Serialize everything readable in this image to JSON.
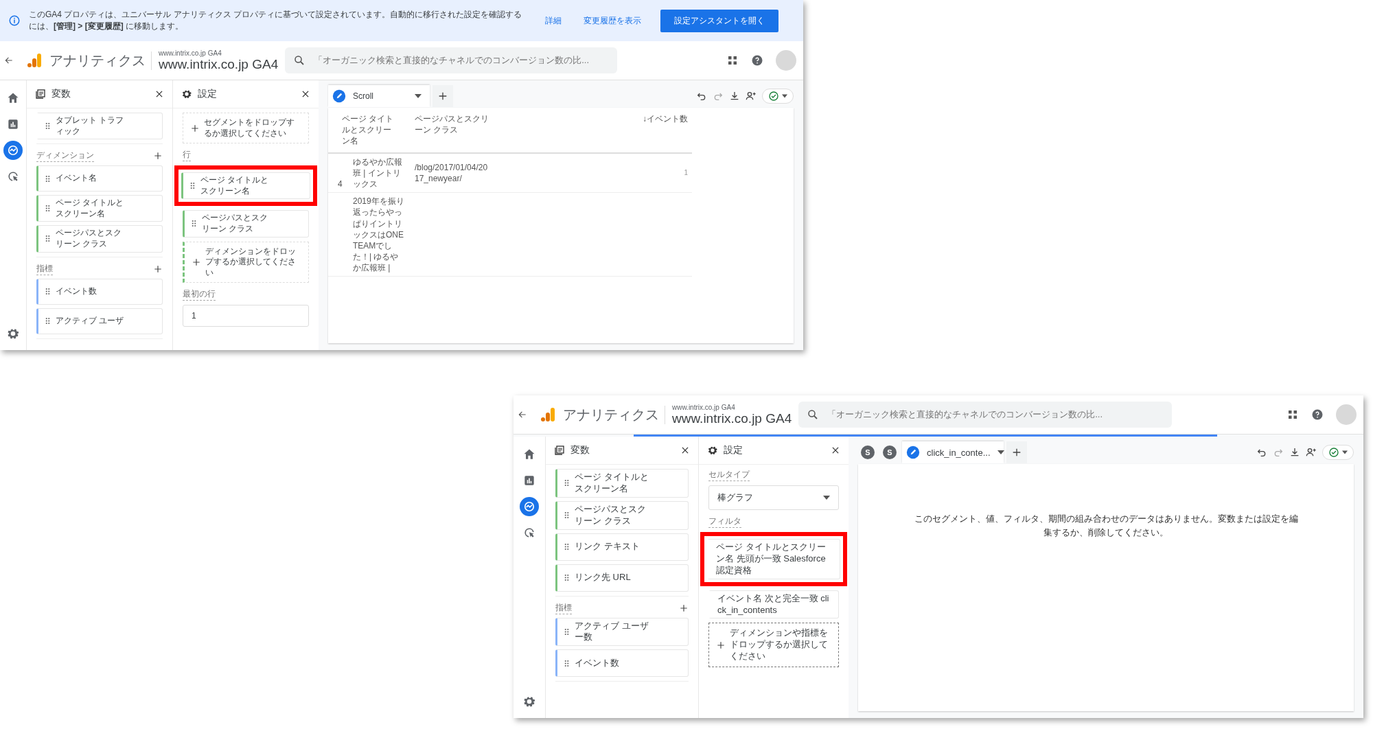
{
  "screens": [
    {
      "banner": {
        "message": "このGA4 プロパティは、ユニバーサル アナリティクス プロパティに基づいて設定されています。自動的に移行された設定を確認するには、**[管理] > [変更履歴]** に移動します。",
        "links": [
          "詳細",
          "変更履歴を表示"
        ],
        "button": "設定アシスタントを開く"
      },
      "header": {
        "app_name": "アナリティクス",
        "account": "www.intrix.co.jp GA4",
        "property": "www.intrix.co.jp GA4",
        "search_placeholder": "「オーガニック検索と直接的なチャネルでのコンバージョン数の比...",
        "loading": false
      },
      "rail": [
        {
          "kind": "home",
          "selected": false
        },
        {
          "kind": "bar-chart",
          "selected": false
        },
        {
          "kind": "trend-circle",
          "selected": true
        },
        {
          "kind": "cursor-target",
          "selected": false
        },
        {
          "kind": "settings",
          "selected": false
        }
      ],
      "variables": {
        "title": "変数",
        "groups": [
          {
            "kind": "segment",
            "items": [
              "タブレット トラフィック"
            ]
          },
          {
            "kind": "dimension",
            "label": "ディメンション",
            "items": [
              "イベント名",
              "ページ タイトルとスクリーン名",
              "ページパスとスクリーン クラス"
            ]
          },
          {
            "kind": "metric",
            "label": "指標",
            "items": [
              "イベント数",
              "アクティブ ユーザ"
            ]
          }
        ]
      },
      "settings": {
        "title": "設定",
        "sections": [
          {
            "kind": "drop",
            "drop": {
              "kind": "segment",
              "text": "セグメントをドロップするか選択してください"
            }
          },
          {
            "kind": "list",
            "label": "行",
            "items": [
              {
                "kind": "dimension",
                "text": "ページ タイトルとスクリーン名",
                "highlighted": true
              },
              {
                "kind": "dimension",
                "text": "ページパスとスクリーン クラス",
                "highlighted": false
              }
            ],
            "drop": {
              "kind": "dimension",
              "text": "ディメンションをドロップするか選択してください"
            }
          },
          {
            "kind": "input",
            "label": "最初の行",
            "value": "1"
          }
        ]
      },
      "canvas": {
        "tabs": [
          {
            "label": "Scroll",
            "selected": true
          }
        ],
        "table": {
          "columns": [
            "ページ タイトルとスクリーン名",
            "ページパスとスクリーン クラス",
            "↓イベント数"
          ],
          "rows": [
            {
              "index": "4",
              "cells": [
                "ゆるやか広報班 | イントリックス",
                "/blog/2017/01/04/2017_newyear/",
                "1"
              ]
            },
            {
              "cells": [
                "2019年を振り返ったらやっぱりイントリックスはONE TEAMでした！| ゆるやか広報班 |"
              ]
            }
          ]
        }
      }
    },
    {
      "header": {
        "app_name": "アナリティクス",
        "account": "www.intrix.co.jp GA4",
        "property": "www.intrix.co.jp GA4",
        "search_placeholder": "「オーガニック検索と直接的なチャネルでのコンバージョン数の比...",
        "loading": true
      },
      "rail": [
        {
          "kind": "home",
          "selected": false
        },
        {
          "kind": "bar-chart",
          "selected": false
        },
        {
          "kind": "trend-circle",
          "selected": true
        },
        {
          "kind": "cursor-target",
          "selected": false
        },
        {
          "kind": "settings",
          "selected": false
        }
      ],
      "variables": {
        "title": "変数",
        "groups": [
          {
            "kind": "dimension",
            "items": [
              "ページ タイトルとスクリーン名",
              "ページパスとスクリーン クラス",
              "リンク テキスト",
              "リンク先 URL"
            ]
          },
          {
            "kind": "metric",
            "label": "指標",
            "items": [
              "アクティブ ユーザー数",
              "イベント数"
            ]
          }
        ]
      },
      "settings": {
        "title": "設定",
        "sections": [
          {
            "kind": "select",
            "label": "セルタイプ",
            "value": "棒グラフ"
          },
          {
            "kind": "list",
            "label": "フィルタ",
            "items": [
              {
                "kind": "filter",
                "text": "ページ タイトルとスクリーン名 先頭が一致 Salesforce 認定資格",
                "highlighted": true
              },
              {
                "kind": "filter",
                "text": "イベント名 次と完全一致 click_in_contents",
                "highlighted": false
              }
            ],
            "drop": {
              "kind": "filter",
              "text": "ディメンションや指標をドロップするか選択してください"
            }
          }
        ]
      },
      "canvas": {
        "segments": [
          "S",
          "S"
        ],
        "tabs": [
          {
            "label": "click_in_conte...",
            "selected": true
          }
        ],
        "message": "このセグメント、値、フィルタ、期間の組み合わせのデータはありません。変数または設定を編集するか、削除してください。"
      }
    }
  ]
}
